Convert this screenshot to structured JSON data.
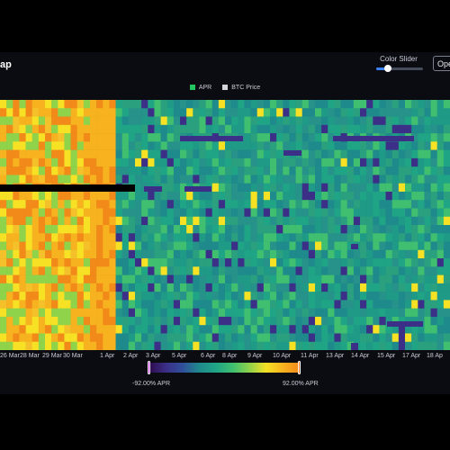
{
  "title": "ap",
  "color_slider": {
    "label": "Color Slider",
    "value": 0.25
  },
  "open_button": {
    "label": "Ope"
  },
  "legend": [
    {
      "label": "APR",
      "color": "#22c55e"
    },
    {
      "label": "BTC Price",
      "color": "#d1d5db"
    }
  ],
  "x_axis": {
    "labels": [
      "26 Mar",
      "28 Mar",
      "29 Mar",
      "30 Mar",
      "1 Apr",
      "2 Apr",
      "3 Apr",
      "5 Apr",
      "6 Apr",
      "8 Apr",
      "9 Apr",
      "10 Apr",
      "11 Apr",
      "13 Apr",
      "14 Apr",
      "15 Apr",
      "17 Apr",
      "18 Ap"
    ]
  },
  "colorbar": {
    "min_label": "-92.00% APR",
    "max_label": "92.00% APR",
    "colors": [
      "#2d0b4e",
      "#3b2f87",
      "#30509b",
      "#1f8a8c",
      "#20a486",
      "#3fbf6f",
      "#8fd34a",
      "#f6e125",
      "#f7b21f",
      "#f28a1a"
    ]
  },
  "chart_data": {
    "type": "heatmap",
    "xlabel": "",
    "ylabel": "",
    "colorscale": [
      "#2d0b4e",
      "#3b2f87",
      "#30509b",
      "#1f8a8c",
      "#20a486",
      "#3fbf6f",
      "#8fd34a",
      "#f6e125",
      "#f7b21f",
      "#f28a1a"
    ],
    "value_range": [
      -92,
      92
    ],
    "columns_visible": 70,
    "rows_visible": 30
  }
}
